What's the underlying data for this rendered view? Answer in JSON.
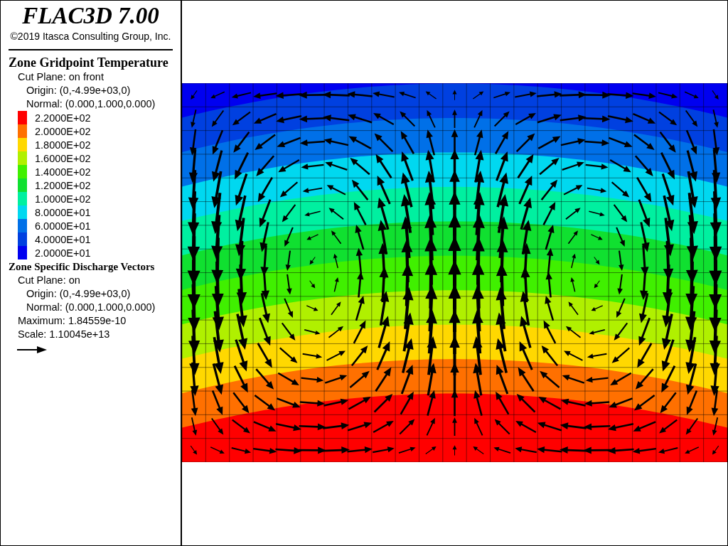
{
  "header": {
    "title": "FLAC3D 7.00",
    "copyright": "©2019 Itasca Consulting Group, Inc."
  },
  "plot_items": [
    {
      "title": "Zone Gridpoint Temperature",
      "lines": [
        {
          "kind": "setting",
          "text": "Cut Plane: on front"
        },
        {
          "kind": "detail",
          "text": "Origin: (0,-4.99e+03,0)"
        },
        {
          "kind": "detail",
          "text": "Normal: (0.000,1.000,0.000)"
        }
      ],
      "legend": [
        {
          "label": "2.2000E+02",
          "color": "#ff0000"
        },
        {
          "label": "2.0000E+02",
          "color": "#ff7000"
        },
        {
          "label": "1.8000E+02",
          "color": "#ffd800"
        },
        {
          "label": "1.6000E+02",
          "color": "#b0f000"
        },
        {
          "label": "1.4000E+02",
          "color": "#40f000"
        },
        {
          "label": "1.2000E+02",
          "color": "#10e030"
        },
        {
          "label": "1.0000E+02",
          "color": "#00f0a0"
        },
        {
          "label": "8.0000E+01",
          "color": "#00d8f0"
        },
        {
          "label": "6.0000E+01",
          "color": "#0070e8"
        },
        {
          "label": "4.0000E+01",
          "color": "#0040e0"
        },
        {
          "label": "2.0000E+01",
          "color": "#0000f0"
        }
      ]
    },
    {
      "title": "Zone Specific Discharge Vectors",
      "lines": [
        {
          "kind": "setting",
          "text": "Cut Plane: on"
        },
        {
          "kind": "detail",
          "text": "Origin: (0,-4.99e+03,0)"
        },
        {
          "kind": "detail",
          "text": "Normal: (0.000,1.000,0.000)"
        },
        {
          "kind": "setting",
          "text": "Maximum: 1.84559e-10"
        },
        {
          "kind": "setting",
          "text": "Scale: 1.10045e+13"
        }
      ],
      "scale_arrow": true
    }
  ]
}
